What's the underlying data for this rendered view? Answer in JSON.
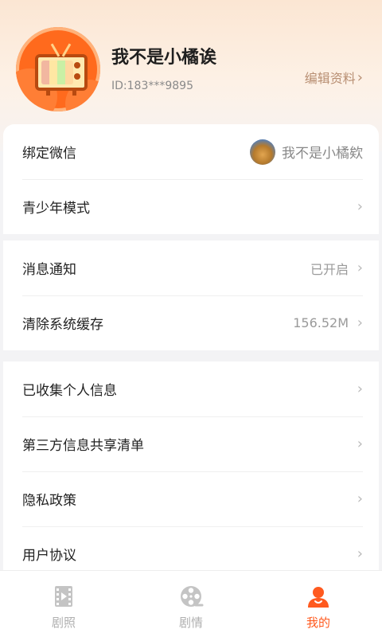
{
  "profile": {
    "username": "我不是小橘诶",
    "user_id": "ID:183***9895",
    "edit_label": "编辑资料",
    "avatar_icon": "retro-tv-icon"
  },
  "settings": {
    "group1": [
      {
        "label": "绑定微信",
        "value": "我不是小橘欸",
        "has_avatar": true
      },
      {
        "label": "青少年模式",
        "value": ""
      }
    ],
    "group2": [
      {
        "label": "消息通知",
        "value": "已开启"
      },
      {
        "label": "清除系统缓存",
        "value": "156.52M"
      }
    ],
    "group3": [
      {
        "label": "已收集个人信息",
        "value": ""
      },
      {
        "label": "第三方信息共享清单",
        "value": ""
      },
      {
        "label": "隐私政策",
        "value": ""
      },
      {
        "label": "用户协议",
        "value": ""
      }
    ]
  },
  "tabbar": {
    "tabs": [
      {
        "label": "剧照",
        "icon": "film-icon",
        "active": false
      },
      {
        "label": "剧情",
        "icon": "film-reel-icon",
        "active": false
      },
      {
        "label": "我的",
        "icon": "user-icon",
        "active": true
      }
    ]
  },
  "colors": {
    "accent": "#ff5a1f",
    "edit_link": "#b88f73"
  }
}
